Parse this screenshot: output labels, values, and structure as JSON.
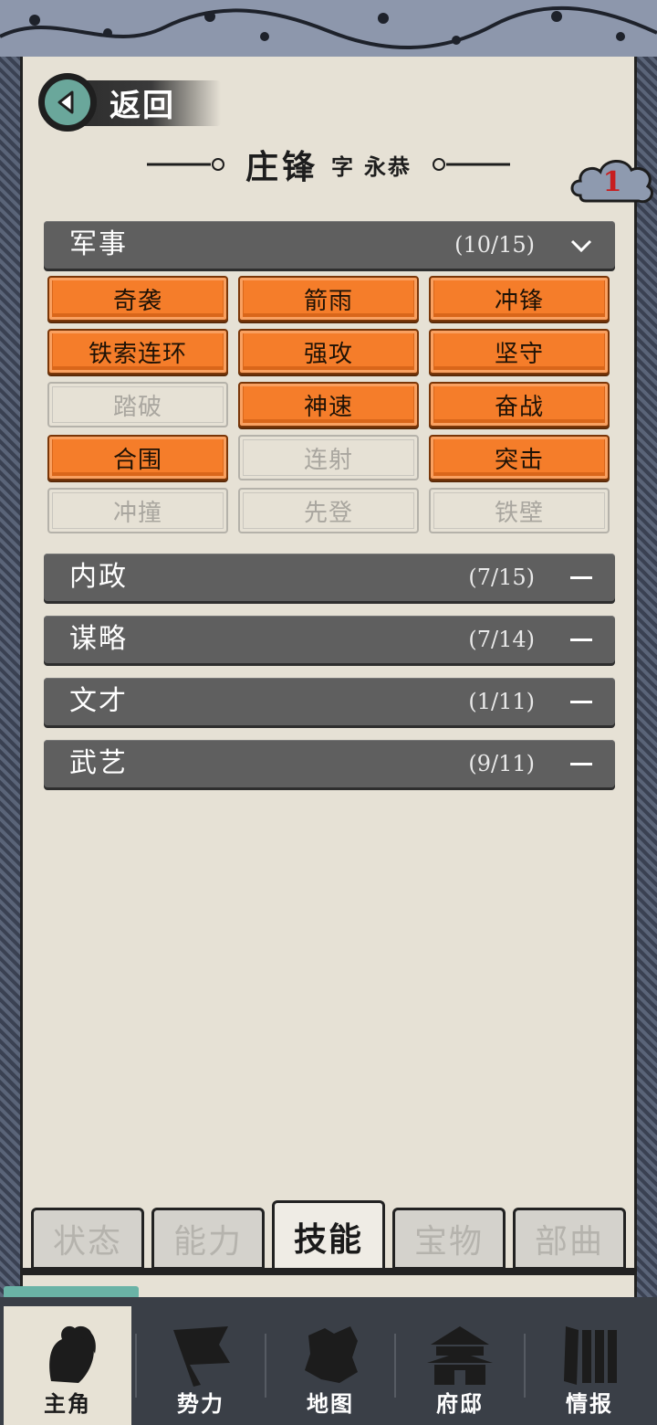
{
  "header": {
    "back_label": "返回",
    "name": "庄锋",
    "zi_label": "字",
    "courtesy_name": "永恭",
    "notification_count": "1"
  },
  "sections": [
    {
      "name": "军事",
      "count": "(10/15)",
      "expanded": true
    },
    {
      "name": "内政",
      "count": "(7/15)",
      "expanded": false
    },
    {
      "name": "谋略",
      "count": "(7/14)",
      "expanded": false
    },
    {
      "name": "文才",
      "count": "(1/11)",
      "expanded": false
    },
    {
      "name": "武艺",
      "count": "(9/11)",
      "expanded": false
    }
  ],
  "military_skills": [
    {
      "label": "奇袭",
      "learned": true
    },
    {
      "label": "箭雨",
      "learned": true
    },
    {
      "label": "冲锋",
      "learned": true
    },
    {
      "label": "铁索连环",
      "learned": true
    },
    {
      "label": "强攻",
      "learned": true
    },
    {
      "label": "坚守",
      "learned": true
    },
    {
      "label": "踏破",
      "learned": false
    },
    {
      "label": "神速",
      "learned": true
    },
    {
      "label": "奋战",
      "learned": true
    },
    {
      "label": "合围",
      "learned": true
    },
    {
      "label": "连射",
      "learned": false
    },
    {
      "label": "突击",
      "learned": true
    },
    {
      "label": "冲撞",
      "learned": false
    },
    {
      "label": "先登",
      "learned": false
    },
    {
      "label": "铁壁",
      "learned": false
    }
  ],
  "tabs": [
    {
      "label": "状态",
      "active": false
    },
    {
      "label": "能力",
      "active": false
    },
    {
      "label": "技能",
      "active": true
    },
    {
      "label": "宝物",
      "active": false
    },
    {
      "label": "部曲",
      "active": false
    }
  ],
  "bottom_nav": [
    {
      "label": "主角",
      "icon": "hero-icon",
      "active": true
    },
    {
      "label": "势力",
      "icon": "flag-icon",
      "active": false
    },
    {
      "label": "地图",
      "icon": "map-icon",
      "active": false
    },
    {
      "label": "府邸",
      "icon": "mansion-icon",
      "active": false
    },
    {
      "label": "情报",
      "icon": "scroll-icon",
      "active": false
    }
  ],
  "colors": {
    "learned_skill": "#f57d2a",
    "section_header": "#5f5f5f",
    "paper": "#e6e1d5",
    "accent_teal": "#6ab3a6",
    "notification": "#c81e1e"
  }
}
